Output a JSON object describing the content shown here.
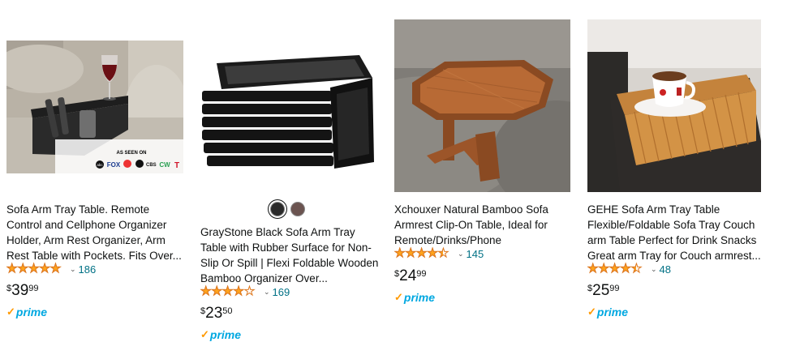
{
  "products": [
    {
      "title": "Sofa Arm Tray Table. Remote Control and Cellphone Organizer Holder, Arm Rest Organizer, Arm Rest Table with Pockets. Fits Over...",
      "rating": 4.5,
      "review_count": "186",
      "price_symbol": "$",
      "price_whole": "39",
      "price_fraction": "99",
      "prime_label": "prime",
      "image_overlay": {
        "as_seen_on": "AS SEEN ON",
        "logos": [
          "abc",
          "FOX",
          "NBC",
          "CBS",
          "CW",
          "T"
        ]
      }
    },
    {
      "title": "GrayStone Black Sofa Arm Tray Table with Rubber Surface for Non-Slip Or Spill | Flexi Foldable Wooden Bamboo Organizer Over...",
      "rating": 3.5,
      "review_count": "169",
      "price_symbol": "$",
      "price_whole": "23",
      "price_fraction": "50",
      "prime_label": "prime",
      "swatch_colors": [
        "#2a2a2a",
        "#6b5450"
      ]
    },
    {
      "title": "Xchouxer Natural Bamboo Sofa Armrest Clip-On Table, Ideal for Remote/Drinks/Phone",
      "rating": 4.0,
      "review_count": "145",
      "price_symbol": "$",
      "price_whole": "24",
      "price_fraction": "99",
      "prime_label": "prime"
    },
    {
      "title": "GEHE Sofa Arm Tray Table Flexible/Foldable Sofa Tray Couch arm Table Perfect for Drink Snacks Great arm Tray for Couch armrest...",
      "rating": 4.0,
      "review_count": "48",
      "price_symbol": "$",
      "price_whole": "25",
      "price_fraction": "99",
      "prime_label": "prime"
    }
  ],
  "colors": {
    "star": "#ffa41c",
    "link": "#007185",
    "prime_blue": "#00a8e1",
    "prime_orange": "#ff9900"
  }
}
